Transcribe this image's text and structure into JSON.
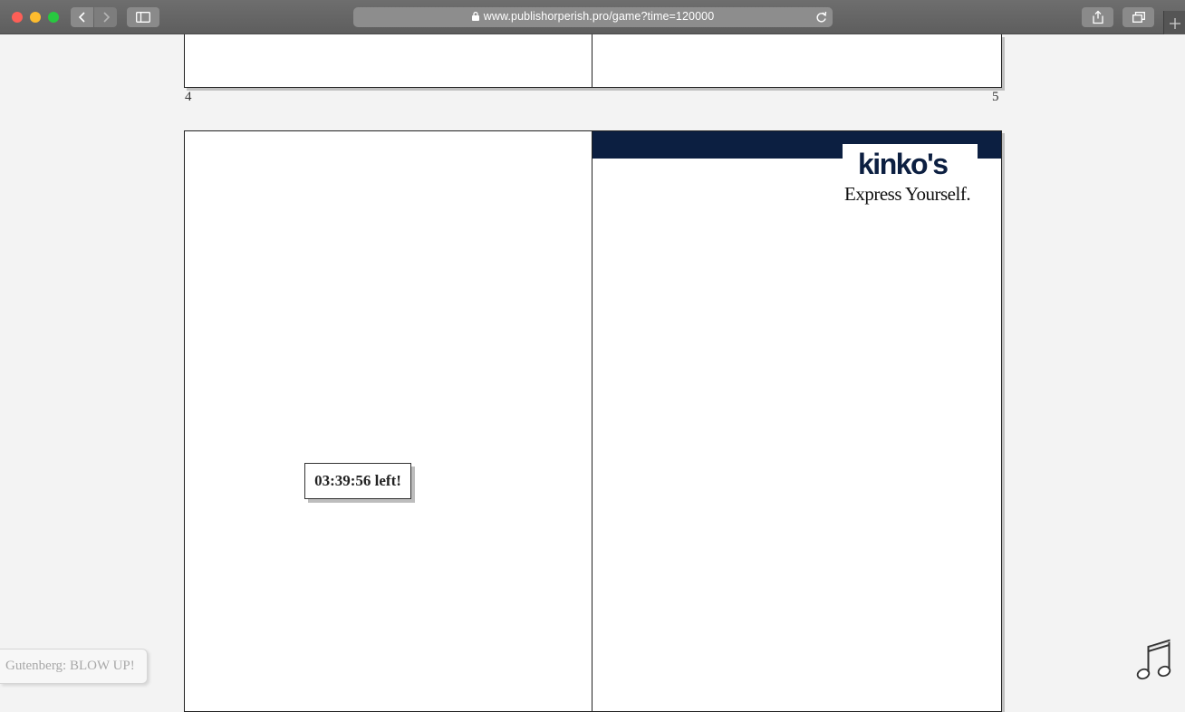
{
  "browser": {
    "url": "www.publishorperish.pro/game?time=120000"
  },
  "page": {
    "page_number_left": "4",
    "page_number_right": "5",
    "ad": {
      "brand": "kinko's",
      "tagline": "Express Yourself.",
      "band_color": "#0c1f41"
    },
    "timer": {
      "label": "03:39:56 left!"
    },
    "chat_message": "Gutenberg: BLOW UP!"
  },
  "icons": {
    "toolbar": [
      "back-icon",
      "forward-icon",
      "sidebar-icon",
      "lock-icon",
      "reload-icon",
      "share-icon",
      "tabs-icon",
      "new-tab-icon"
    ],
    "page": [
      "music-note-icon"
    ]
  }
}
